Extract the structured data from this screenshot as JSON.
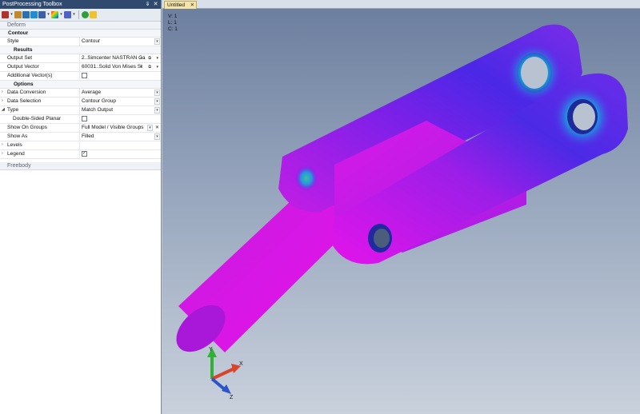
{
  "toolbox": {
    "title": "PostProcessing Toolbox",
    "pin_glyph": "⇓",
    "close_glyph": "✕",
    "sections": {
      "deform": "Deform",
      "freebody": "Freebody"
    },
    "contour": {
      "header": "Contour",
      "style_label": "Style",
      "style_value": "Contour"
    },
    "results": {
      "header": "Results",
      "output_set_label": "Output Set",
      "output_set_value": "2..Simcenter NASTRAN Ca",
      "output_vector_label": "Output Vector",
      "output_vector_value": "60031..Solid Von Mises St",
      "additional_vectors_label": "Additional Vector(s)"
    },
    "options": {
      "header": "Options",
      "data_conversion_label": "Data Conversion",
      "data_conversion_value": "Average",
      "data_selection_label": "Data Selection",
      "data_selection_value": "Contour Group",
      "type_label": "Type",
      "type_value": "Match Output",
      "double_sided_label": "Double-Sided Planar",
      "show_on_groups_label": "Show On Groups",
      "show_on_groups_value": "Full Model / Visible Groups",
      "show_as_label": "Show As",
      "show_as_value": "Filled",
      "levels_label": "Levels",
      "legend_label": "Legend",
      "legend_checked": true
    }
  },
  "viewport": {
    "tab_label": "Untitled",
    "info_v": "V: 1",
    "info_l": "L: 1",
    "info_c": "C: 1",
    "axis_x": "X",
    "axis_y": "Y",
    "axis_z": "Z"
  },
  "colors": {
    "panel_title": "#2f4a6e",
    "tab_active": "#f4e4a8",
    "contour_low": "#e011e8",
    "contour_mid": "#5a22e8",
    "contour_high": "#19d2b0"
  }
}
